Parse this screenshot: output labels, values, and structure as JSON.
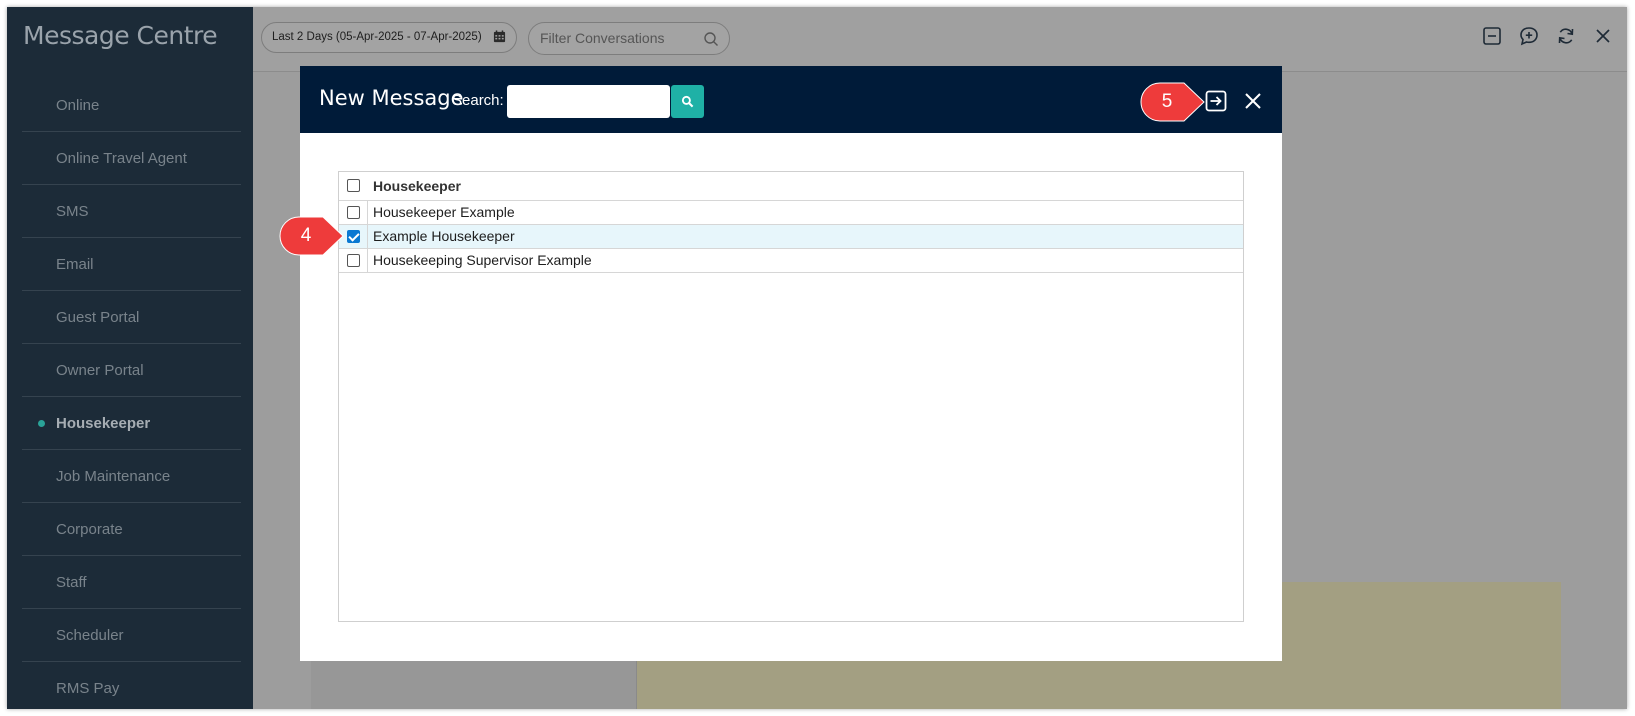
{
  "app": {
    "title": "Message Centre"
  },
  "sidebar": {
    "items": [
      {
        "label": "Online",
        "active": false
      },
      {
        "label": "Online Travel Agent",
        "active": false
      },
      {
        "label": "SMS",
        "active": false
      },
      {
        "label": "Email",
        "active": false
      },
      {
        "label": "Guest Portal",
        "active": false
      },
      {
        "label": "Owner Portal",
        "active": false
      },
      {
        "label": "Housekeeper",
        "active": true
      },
      {
        "label": "Job Maintenance",
        "active": false
      },
      {
        "label": "Corporate",
        "active": false
      },
      {
        "label": "Staff",
        "active": false
      },
      {
        "label": "Scheduler",
        "active": false
      },
      {
        "label": "RMS Pay",
        "active": false
      }
    ]
  },
  "toolbar": {
    "date_range": "Last 2 Days (05-Apr-2025 - 07-Apr-2025)",
    "filter_placeholder": "Filter Conversations",
    "icons": [
      "minimize-icon",
      "new-chat-icon",
      "refresh-icon",
      "close-icon"
    ]
  },
  "modal": {
    "title": "New Message",
    "search_label": "Search:",
    "search_value": "",
    "header_row": {
      "label": "Housekeeper",
      "checked": false
    },
    "rows": [
      {
        "label": "Housekeeper Example",
        "checked": false
      },
      {
        "label": "Example Housekeeper",
        "checked": true
      },
      {
        "label": "Housekeeping Supervisor Example",
        "checked": false
      }
    ]
  },
  "callouts": {
    "step4": "4",
    "step5": "5"
  },
  "colors": {
    "sidebar_bg": "#1c2b38",
    "modal_header_bg": "#001b39",
    "accent_teal": "#1fb1a6",
    "callout_red": "#ee3b3b"
  }
}
